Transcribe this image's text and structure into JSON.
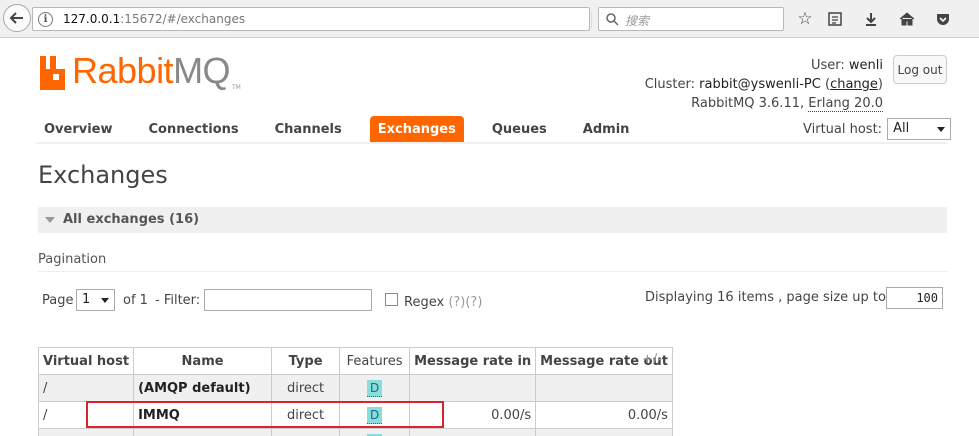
{
  "browser": {
    "url_host": "127.0.0.1",
    "url_rest": ":15672/#/exchanges",
    "search_placeholder": "搜索"
  },
  "header": {
    "logo_text_orange": "Rabbit",
    "logo_text_gray": "MQ",
    "logo_tm": "TM",
    "user_prefix": "User:",
    "user": "wenli",
    "cluster_prefix": "Cluster:",
    "cluster": "rabbit@yswenli-PC",
    "change_link": "change",
    "version": "RabbitMQ 3.6.11,",
    "erlang": "Erlang 20.0",
    "logout": "Log out"
  },
  "nav": {
    "tabs": [
      {
        "label": "Overview"
      },
      {
        "label": "Connections"
      },
      {
        "label": "Channels"
      },
      {
        "label": "Exchanges"
      },
      {
        "label": "Queues"
      },
      {
        "label": "Admin"
      }
    ],
    "active_tab": "Exchanges",
    "virtual_host_label": "Virtual host:",
    "virtual_host_value": "All"
  },
  "page": {
    "title": "Exchanges",
    "section_label": "All exchanges (16)",
    "pagination_label": "Pagination"
  },
  "pagination": {
    "page_label": "Page",
    "page_value": "1",
    "of_label": "of 1",
    "filter_label": "- Filter:",
    "filter_value": "",
    "regex_label": "Regex",
    "regex_help": "(?)(?)",
    "displaying": "Displaying 16 items , page size up to:",
    "page_size": "100"
  },
  "table": {
    "headers": [
      "Virtual host",
      "Name",
      "Type",
      "Features",
      "Message rate in",
      "Message rate out"
    ],
    "plus_minus": "+/-",
    "rows": [
      {
        "vhost": "/",
        "name": "(AMQP default)",
        "type": "direct",
        "feature": "D",
        "rate_in": "",
        "rate_out": ""
      },
      {
        "vhost": "/",
        "name": "IMMQ",
        "type": "direct",
        "feature": "D",
        "rate_in": "0.00/s",
        "rate_out": "0.00/s"
      },
      {
        "vhost": "",
        "name": "",
        "type": "",
        "feature": "D",
        "rate_in": "",
        "rate_out": ""
      }
    ]
  },
  "colors": {
    "accent": "#ff6600",
    "highlight_box": "#d9232d",
    "feature_badge": "#88dddd"
  }
}
